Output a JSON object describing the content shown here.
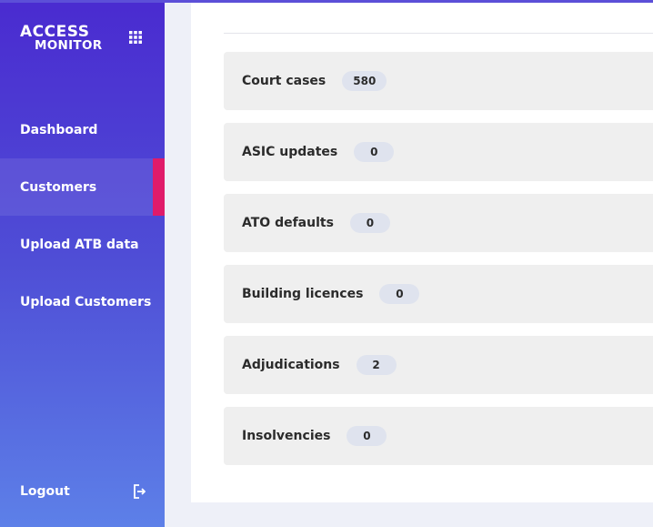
{
  "brand": {
    "line1": "ACCESS",
    "line2": "MONITOR"
  },
  "sidebar": {
    "items": [
      {
        "label": "Dashboard",
        "active": false
      },
      {
        "label": "Customers",
        "active": true
      },
      {
        "label": "Upload ATB data",
        "active": false
      },
      {
        "label": "Upload Customers",
        "active": false
      }
    ],
    "logout_label": "Logout"
  },
  "main": {
    "rows": [
      {
        "label": "Court cases",
        "count": "580"
      },
      {
        "label": "ASIC updates",
        "count": "0"
      },
      {
        "label": "ATO defaults",
        "count": "0"
      },
      {
        "label": "Building licences",
        "count": "0"
      },
      {
        "label": "Adjudications",
        "count": "2"
      },
      {
        "label": "Insolvencies",
        "count": "0"
      }
    ]
  },
  "colors": {
    "sidebar_top": "#4a2bd0",
    "sidebar_bottom": "#5d80e8",
    "active_indicator": "#e01b6a",
    "row_background": "#efefef",
    "badge_background": "#dfe3ee"
  },
  "icons": [
    "apps-grid-icon",
    "logout-icon"
  ]
}
